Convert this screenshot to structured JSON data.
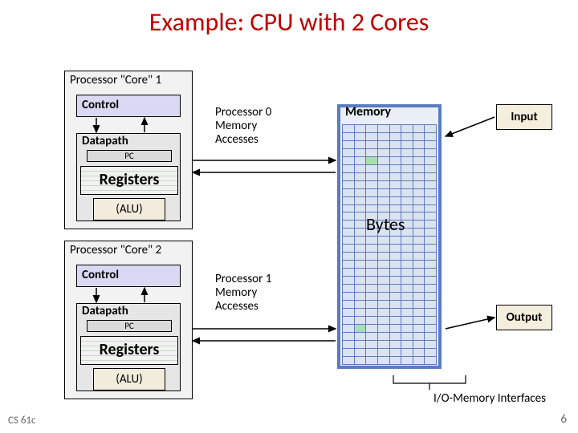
{
  "title": "Example: CPU with 2 Cores",
  "core1": {
    "label": "Processor \"Core\" 1",
    "control": "Control",
    "datapath": "Datapath",
    "pc": "PC",
    "registers": "Registers",
    "alu": "(ALU)"
  },
  "core2": {
    "label": "Processor \"Core\" 2",
    "control": "Control",
    "datapath": "Datapath",
    "pc": "PC",
    "registers": "Registers",
    "alu": "(ALU)"
  },
  "annot1": "Processor 0 Memory Accesses",
  "annot2": "Processor 1 Memory Accesses",
  "memory_label": "Memory",
  "bytes_label": "Bytes",
  "input_label": "Input",
  "output_label": "Output",
  "io_interface_label": "I/O-Memory Interfaces",
  "footer_left": "CS 61c",
  "footer_right": "6",
  "chart_data": {
    "type": "diagram",
    "title": "Example: CPU with 2 Cores",
    "components": [
      {
        "name": "Processor Core 1",
        "parts": [
          "Control",
          "Datapath",
          "PC",
          "Registers",
          "ALU"
        ]
      },
      {
        "name": "Processor Core 2",
        "parts": [
          "Control",
          "Datapath",
          "PC",
          "Registers",
          "ALU"
        ]
      },
      {
        "name": "Memory",
        "contains": "Bytes (grid)"
      },
      {
        "name": "Input",
        "connects_to": "Memory"
      },
      {
        "name": "Output",
        "connects_to": "Memory"
      }
    ],
    "connections": [
      {
        "from": "Core 1 Control",
        "to": "Core 1 Datapath",
        "bidirectional": true
      },
      {
        "from": "Core 2 Control",
        "to": "Core 2 Datapath",
        "bidirectional": true
      },
      {
        "from": "Core 1",
        "to": "Memory",
        "label": "Processor 0 Memory Accesses",
        "bidirectional": true
      },
      {
        "from": "Core 2",
        "to": "Memory",
        "label": "Processor 1 Memory Accesses",
        "bidirectional": true
      },
      {
        "from": "Input",
        "to": "Memory"
      },
      {
        "from": "Memory",
        "to": "Output"
      },
      {
        "from": "I/O-Memory Interfaces",
        "to": "Memory (bottom)",
        "type": "bracket"
      }
    ]
  }
}
